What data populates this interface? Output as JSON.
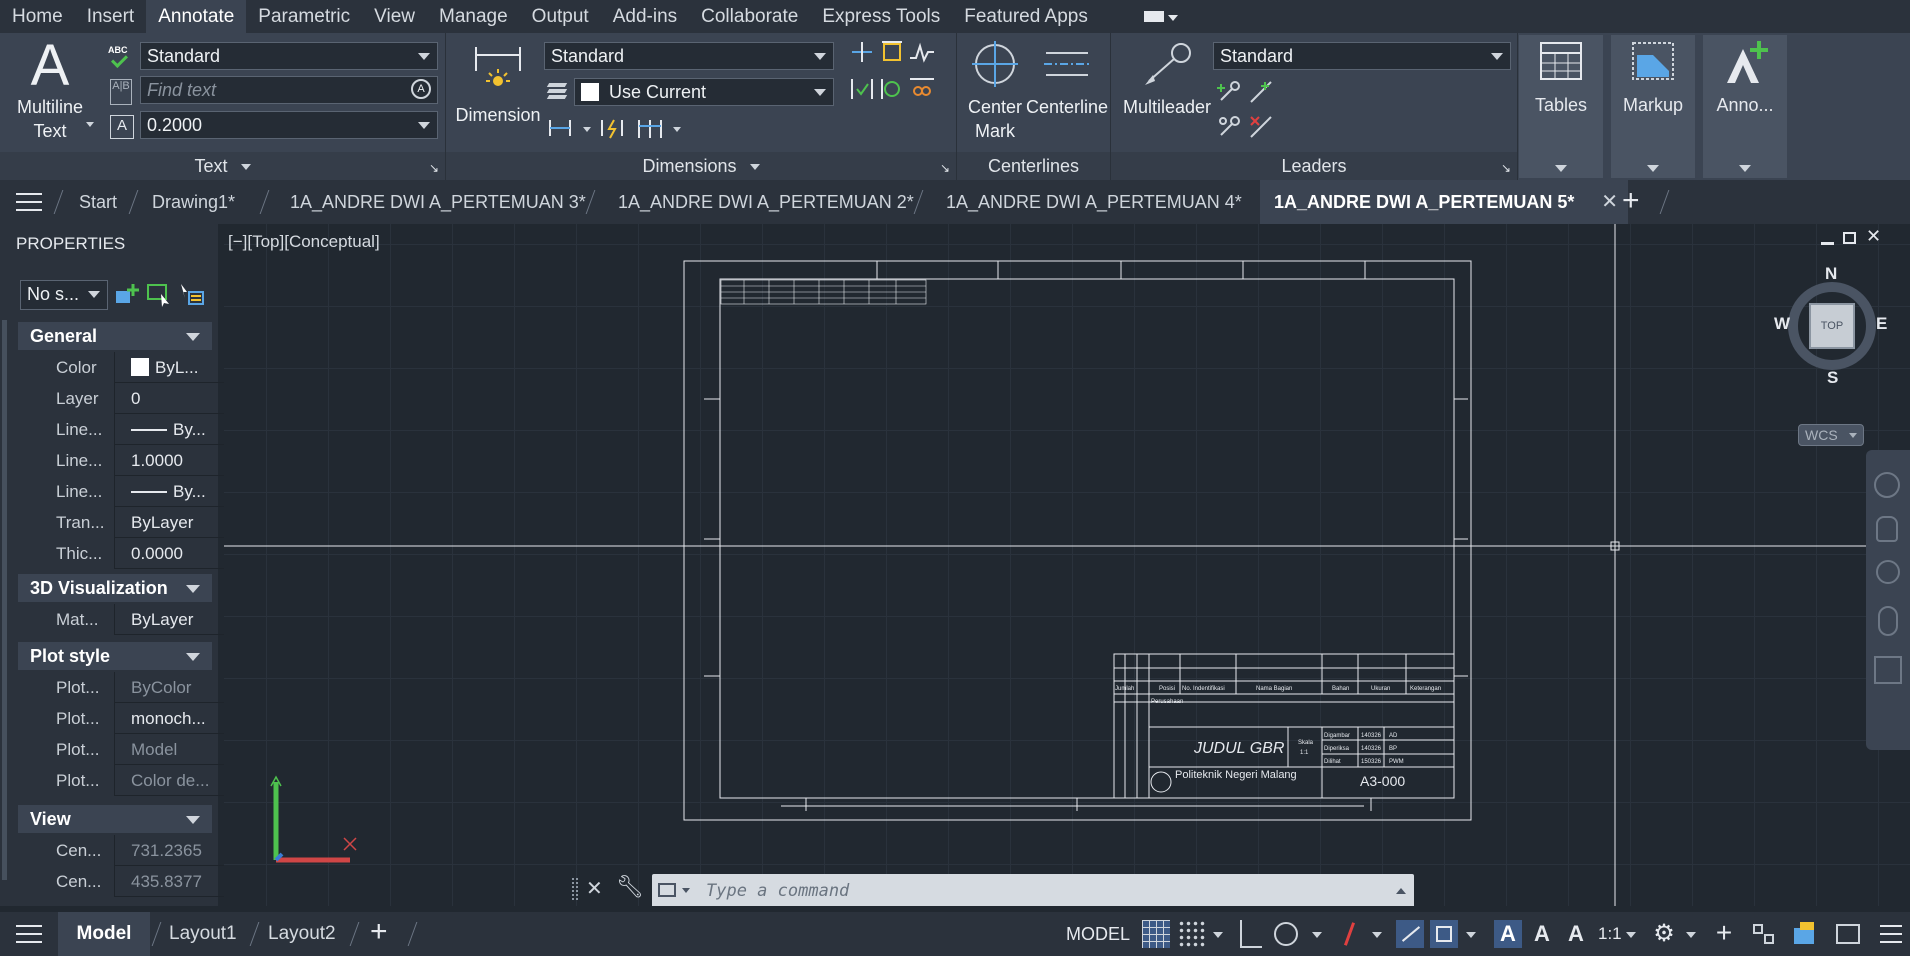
{
  "menu": [
    "Home",
    "Insert",
    "Annotate",
    "Parametric",
    "View",
    "Manage",
    "Output",
    "Add-ins",
    "Collaborate",
    "Express Tools",
    "Featured Apps"
  ],
  "menu_active": "Annotate",
  "ribbon": {
    "text_panel": {
      "big_label_1": "Multiline",
      "big_label_2": "Text",
      "style": "Standard",
      "find_placeholder": "Find text",
      "height": "0.2000",
      "title": "Text",
      "abc": "ABC"
    },
    "dimensions_panel": {
      "big_label": "Dimension",
      "style": "Standard",
      "layer": "Use Current",
      "title": "Dimensions"
    },
    "centerlines_panel": {
      "center_mark_1": "Center",
      "center_mark_2": "Mark",
      "centerline": "Centerline",
      "title": "Centerlines"
    },
    "leaders_panel": {
      "big_label": "Multileader",
      "style": "Standard",
      "title": "Leaders"
    },
    "tables_label": "Tables",
    "markup_label": "Markup",
    "anno_label": "Anno..."
  },
  "tabs": [
    "Start",
    "Drawing1*",
    "1A_ANDRE DWI A_PERTEMUAN 3*",
    "1A_ANDRE DWI A_PERTEMUAN 2*",
    "1A_ANDRE DWI A_PERTEMUAN 4*",
    "1A_ANDRE DWI A_PERTEMUAN 5*"
  ],
  "properties": {
    "title": "PROPERTIES",
    "selector": "No s...",
    "sections": [
      {
        "name": "General",
        "rows": [
          [
            "Color",
            "ByL..."
          ],
          [
            "Layer",
            "0"
          ],
          [
            "Line...",
            "By..."
          ],
          [
            "Line...",
            "1.0000"
          ],
          [
            "Line...",
            "By..."
          ],
          [
            "Tran...",
            "ByLayer"
          ],
          [
            "Thic...",
            "0.0000"
          ]
        ]
      },
      {
        "name": "3D Visualization",
        "rows": [
          [
            "Mat...",
            "ByLayer"
          ]
        ]
      },
      {
        "name": "Plot style",
        "rows": [
          [
            "Plot...",
            "ByColor"
          ],
          [
            "Plot...",
            "monoch..."
          ],
          [
            "Plot...",
            "Model"
          ],
          [
            "Plot...",
            "Color de..."
          ]
        ]
      },
      {
        "name": "View",
        "rows": [
          [
            "Cen...",
            "731.2365"
          ],
          [
            "Cen...",
            "435.8377"
          ]
        ]
      }
    ]
  },
  "viewport": {
    "label": "[−][Top][Conceptual]",
    "compass": {
      "n": "N",
      "s": "S",
      "e": "E",
      "w": "W",
      "top": "TOP"
    },
    "wcs": "WCS",
    "title_block": {
      "judul": "JUDUL GBR",
      "institution": "Politeknik Negeri Malang",
      "sheet": "A3-000",
      "headers": [
        "Jumlah",
        "Posisi",
        "No. Indentifikasi",
        "Nama Bagian",
        "Bahan",
        "Ukuran",
        "Keterangan"
      ],
      "company": "Perusahaan",
      "scale": "Skala",
      "scale_val": "1:1",
      "roles": [
        "Digambar",
        "Diperiksa",
        "Dilihat"
      ],
      "dates": [
        "140326",
        "140326",
        "150326"
      ],
      "initials": [
        "AD",
        "BP",
        "PWM"
      ]
    }
  },
  "command": {
    "placeholder": "Type a command"
  },
  "status": {
    "tabs": [
      "Model",
      "Layout1",
      "Layout2"
    ],
    "model_label": "MODEL",
    "scale": "1:1"
  }
}
